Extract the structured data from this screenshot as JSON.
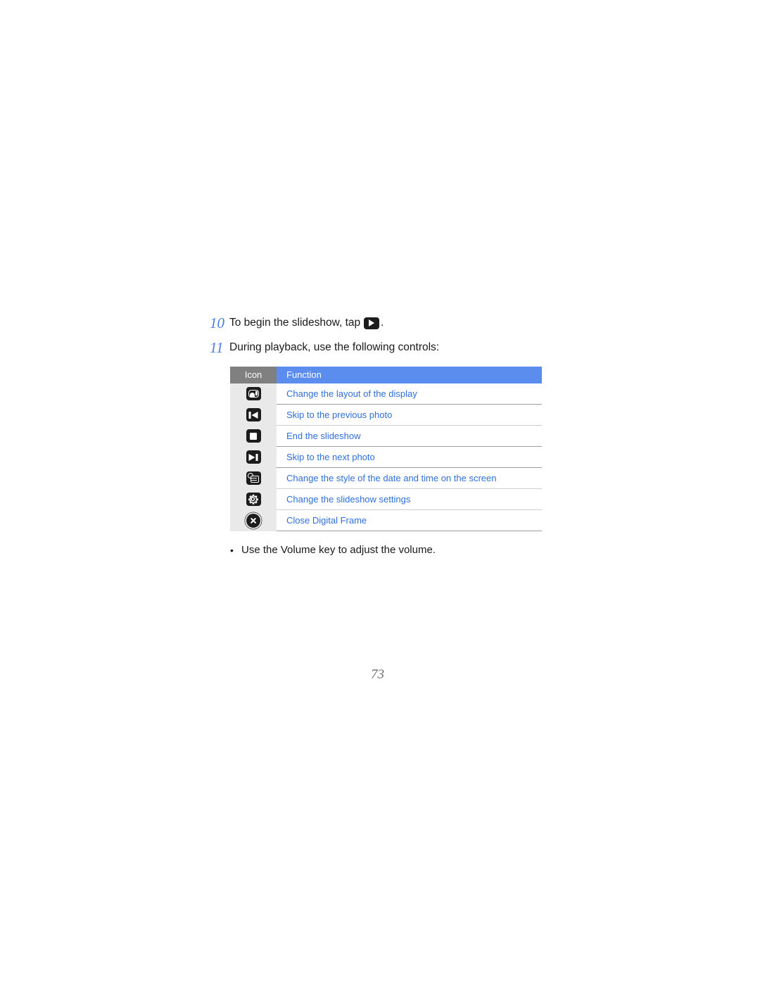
{
  "document": {
    "page_number": "73"
  },
  "steps": [
    {
      "number": "10",
      "text_before": "To begin the slideshow, tap",
      "icon": "play-icon",
      "text_after": "."
    },
    {
      "number": "11",
      "text_before": "During playback, use the following controls:",
      "icon": "",
      "text_after": ""
    }
  ],
  "controls_table": {
    "headers": {
      "icon": "Icon",
      "function": "Function"
    },
    "header_colors": {
      "icon_bg": "#808080",
      "function_bg": "#5b8def",
      "header_text": "#ffffff"
    },
    "row_colors": {
      "icon_cell_bg": "#e9e9e9",
      "function_text": "#2f6fdc"
    },
    "rows": [
      {
        "icon": "display-layout-icon",
        "function": "Change the layout of the display"
      },
      {
        "icon": "skip-previous-icon",
        "function": "Skip to the previous photo"
      },
      {
        "icon": "stop-icon",
        "function": "End the slideshow"
      },
      {
        "icon": "skip-next-icon",
        "function": "Skip to the next photo"
      },
      {
        "icon": "date-time-icon",
        "function": "Change the style of the date and time on the screen"
      },
      {
        "icon": "settings-gear-icon",
        "function": "Change the slideshow settings"
      },
      {
        "icon": "close-circle-icon",
        "function": "Close Digital Frame"
      }
    ]
  },
  "bullet": {
    "marker": "•",
    "text": "Use the Volume key to adjust the volume."
  }
}
